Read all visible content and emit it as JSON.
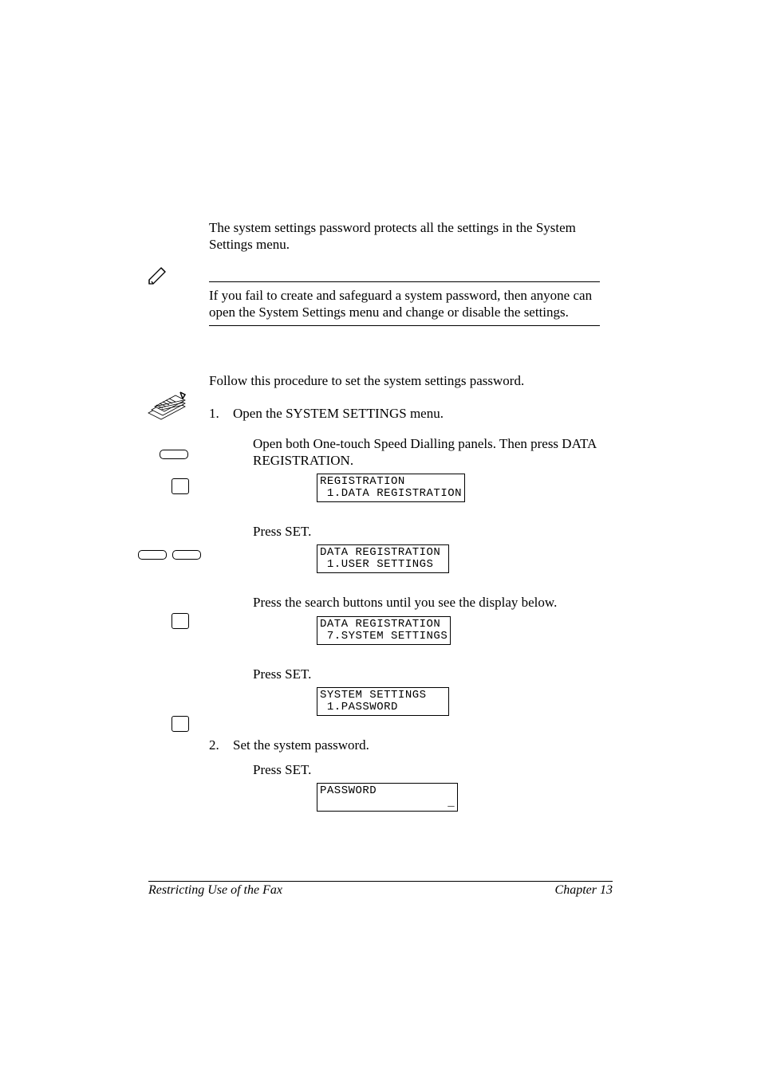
{
  "intro_p1": "The system settings password protects all the settings in the System Settings menu.",
  "note": "If you fail to create and safeguard a system password, then anyone can open the System Settings menu and change or disable the settings.",
  "proc_intro": "Follow this procedure to set the system settings password.",
  "steps": {
    "s1_num": "1.",
    "s1_text": "Open the SYSTEM SETTINGS menu.",
    "s1_sub1": "Open both One-touch Speed Dialling panels. Then press DATA REGISTRATION.",
    "s1_lcd1_l1": "REGISTRATION",
    "s1_lcd1_l2": " 1.DATA REGISTRATION",
    "s1_sub2": "Press SET.",
    "s1_lcd2_l1": "DATA REGISTRATION",
    "s1_lcd2_l2": " 1.USER SETTINGS",
    "s1_sub3": "Press the search buttons until you see the display below.",
    "s1_lcd3_l1": "DATA REGISTRATION",
    "s1_lcd3_l2": " 7.SYSTEM SETTINGS",
    "s1_sub4": "Press SET.",
    "s1_lcd4_l1": "SYSTEM SETTINGS",
    "s1_lcd4_l2": " 1.PASSWORD",
    "s2_num": "2.",
    "s2_text": "Set the system password.",
    "s2_sub1": "Press SET.",
    "s2_lcd1_l1": "PASSWORD",
    "s2_lcd1_l2": "                  _"
  },
  "footer_left": "Restricting Use of the Fax",
  "footer_right": "Chapter 13"
}
